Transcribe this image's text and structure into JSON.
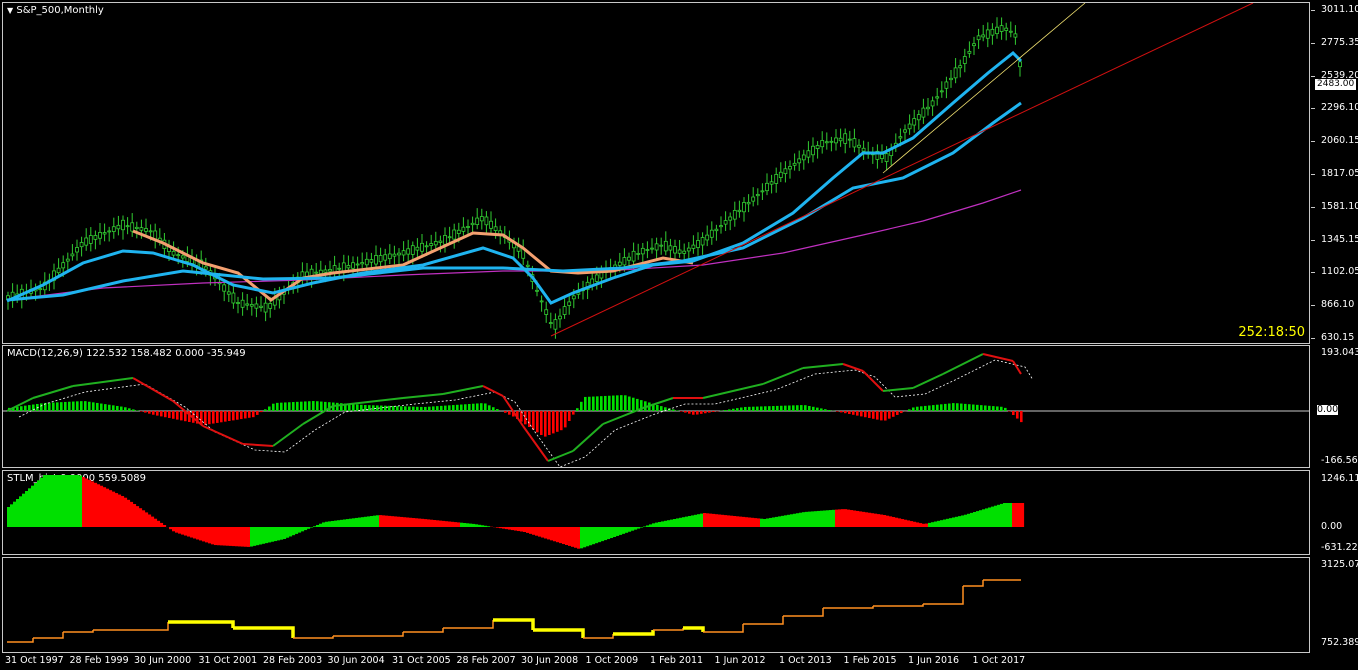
{
  "window": {
    "title": "S&P_500,Monthly",
    "countdown": "252:18:50",
    "current_price": "2483.00",
    "zero_tag": "0.00"
  },
  "price_axis": [
    "3011.10",
    "2775.35",
    "2539.20",
    "2296.10",
    "2060.15",
    "1817.05",
    "1581.10",
    "1345.15",
    "1102.05",
    "866.10",
    "630.15"
  ],
  "macd": {
    "title": "MACD(12,26,9) 122.532 158.482 0.000 -35.949",
    "axis": [
      "193.043",
      "0.00",
      "-166.566"
    ]
  },
  "stlm": {
    "title": "STLM_hist 0.0000 559.5089",
    "axis": [
      "1246.112",
      "0.00",
      "-631.2219"
    ]
  },
  "lower": {
    "axis": [
      "3125.076",
      "752.3892"
    ]
  },
  "time_axis": [
    "31 Oct 1997",
    "28 Feb 1999",
    "30 Jun 2000",
    "31 Oct 2001",
    "28 Feb 2003",
    "30 Jun 2004",
    "31 Oct 2005",
    "28 Feb 2007",
    "30 Jun 2008",
    "1 Oct 2009",
    "1 Feb 2011",
    "1 Jun 2012",
    "1 Oct 2013",
    "1 Feb 2015",
    "1 Jun 2016",
    "1 Oct 2017"
  ],
  "colors": {
    "bull_candle": "#32cd32",
    "fast_ma": "#1fb4f0",
    "orange_ma": "#f4a070",
    "long_ma": "#c030c0",
    "trendline": "#d01010",
    "fan_line": "#f0e070",
    "macd_up": "#20b020",
    "macd_down": "#e01010",
    "hist_up": "#00e000",
    "hist_down": "#ff0000",
    "lower_line": "#ff9020",
    "lower_highlight": "#ffff00"
  }
}
